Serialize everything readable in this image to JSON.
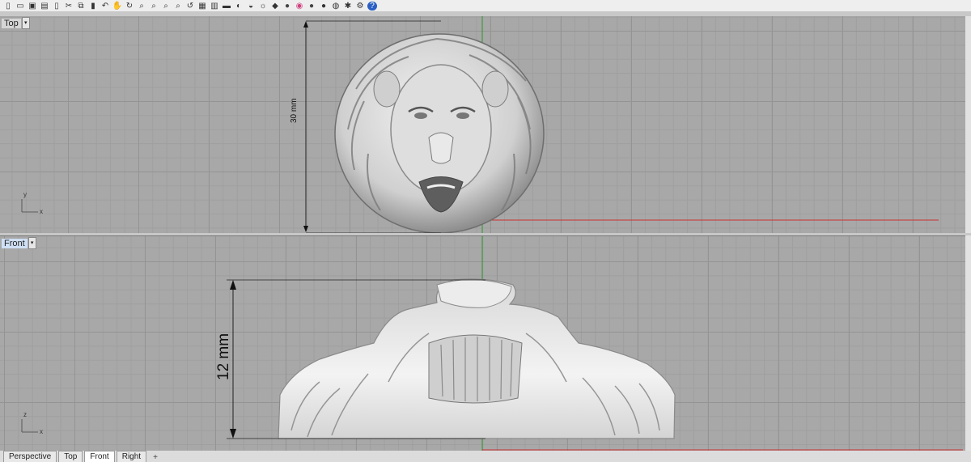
{
  "toolbar": {
    "icons": [
      "new-file-icon",
      "open-folder-icon",
      "save-icon",
      "print-icon",
      "import-icon",
      "cut-icon",
      "copy-icon",
      "paste-icon",
      "undo-icon",
      "pan-hand-icon",
      "rotate-view-icon",
      "zoom-window-icon",
      "zoom-dynamic-icon",
      "zoom-extents-icon",
      "zoom-selected-icon",
      "rotate-icon",
      "grid-icon",
      "viewport-layout-icon",
      "set-view-icon",
      "shade-icon",
      "display-mode-icon",
      "light-icon",
      "mesh-icon",
      "render-icon",
      "color-wheel-icon",
      "sphere-icon",
      "material-sphere-icon",
      "environment-icon",
      "settings-gear-icon",
      "options-icon",
      "help-icon"
    ]
  },
  "viewports": {
    "top": {
      "label": "Top",
      "dimension_label": "30 mm"
    },
    "front": {
      "label": "Front",
      "dimension_label": "12 mm"
    }
  },
  "axes": {
    "top": {
      "x": "x",
      "y": "y"
    },
    "front": {
      "x": "x",
      "z": "z"
    }
  },
  "tabs": [
    "Perspective",
    "Top",
    "Front",
    "Right"
  ],
  "active_tab": "Front",
  "colors": {
    "x_axis": "#cc3030",
    "y_axis": "#2a9a2a",
    "grid_bg": "#a8a8a8"
  }
}
